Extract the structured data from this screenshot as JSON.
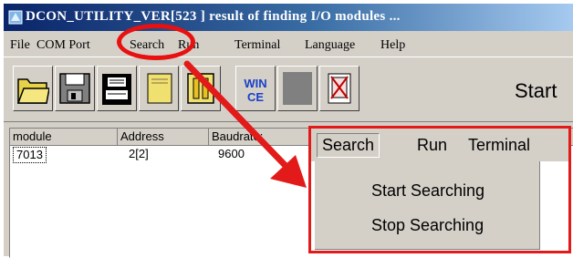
{
  "window": {
    "title": "DCON_UTILITY_VER[523 ] result of finding I/O modules ..."
  },
  "menubar": {
    "items": [
      "File",
      "COM Port",
      "Search",
      "Run",
      "Terminal",
      "Language",
      "Help"
    ]
  },
  "toolbar": {
    "buttons": [
      {
        "icon": "open-folder-icon"
      },
      {
        "icon": "floppy-disk-icon"
      },
      {
        "icon": "print-icon"
      },
      {
        "icon": "search-icon"
      },
      {
        "icon": "pause-icon"
      },
      {
        "icon": "win-ce-icon",
        "text": "WIN CE"
      },
      {
        "icon": "blank-button"
      },
      {
        "icon": "remove-module-icon"
      }
    ],
    "start_label": "Start"
  },
  "list": {
    "columns": [
      "module",
      "Address",
      "Baudrate:"
    ],
    "rows": [
      {
        "module": "7013",
        "address": "2[2]",
        "baudrate": "9600"
      }
    ]
  },
  "zoom": {
    "menubar": [
      "Search",
      "Run",
      "Terminal"
    ],
    "dropdown": [
      "Start Searching",
      "Stop Searching"
    ]
  },
  "colors": {
    "highlight": "#e31a1a",
    "title_start": "#0a246a",
    "title_end": "#a6caf0",
    "chrome": "#d4d0c8"
  }
}
